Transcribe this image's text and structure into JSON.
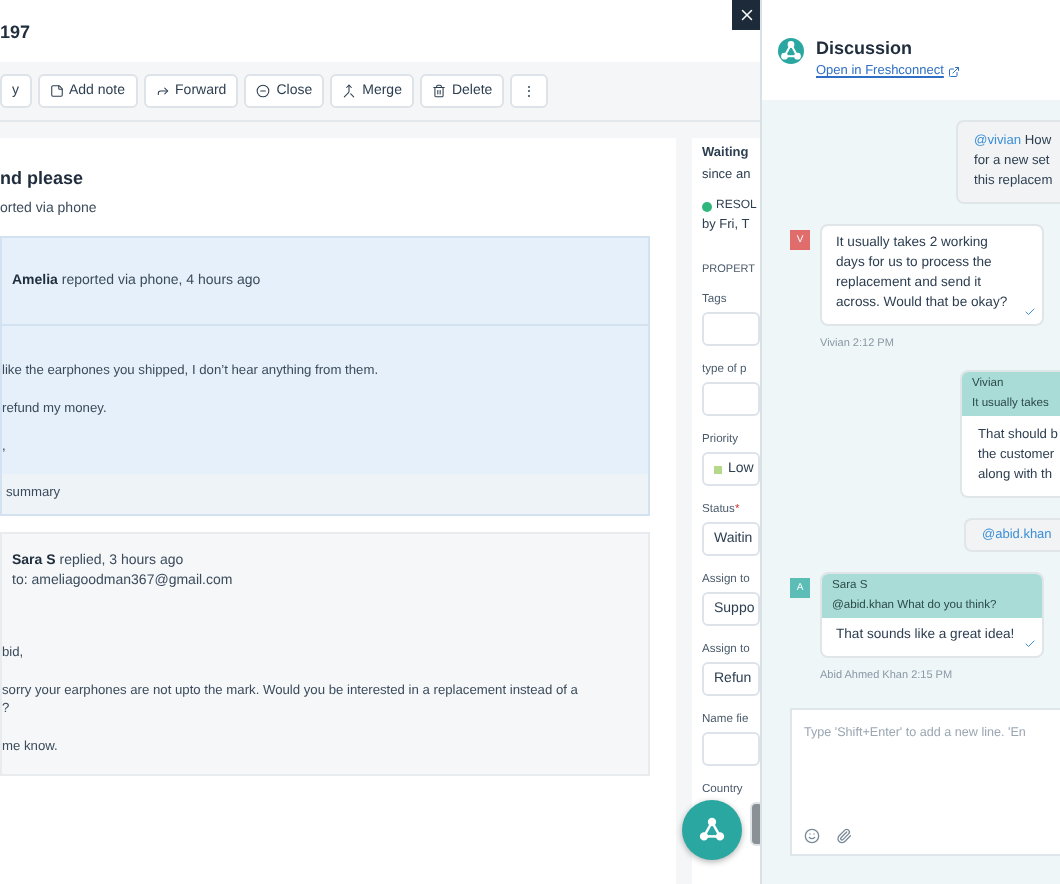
{
  "header": {
    "title": "197"
  },
  "toolbar": [
    {
      "label": "y",
      "kind": "plain"
    },
    {
      "label": "Add note",
      "kind": "note"
    },
    {
      "label": "Forward",
      "kind": "forward"
    },
    {
      "label": "Close",
      "kind": "close"
    },
    {
      "label": "Merge",
      "kind": "merge"
    },
    {
      "label": "Delete",
      "kind": "delete"
    },
    {
      "label": "⋮",
      "kind": "plain"
    }
  ],
  "ticket": {
    "subject": "nd please",
    "source": "orted via phone"
  },
  "messages": [
    {
      "kind": "customer",
      "author": "Amelia",
      "meta": "reported via phone, 4 hours ago",
      "lines": [
        "like the earphones you shipped, I don’t hear anything from them.",
        "refund my money.",
        ","
      ],
      "footer": "summary"
    },
    {
      "kind": "agent",
      "author": "Sara S",
      "meta": "replied, 3 hours ago",
      "to": "to: ameliagoodman367@gmail.com",
      "lines": [
        "bid,",
        "sorry your earphones are not upto the mark. Would you be interested in a replacement instead of a\n?",
        "me know."
      ]
    }
  ],
  "properties": {
    "status_title": "Waiting",
    "status_since": "since an",
    "sla_badge": "RESOL",
    "sla_due": "by Fri, T",
    "heading": "PROPERT",
    "fields": [
      {
        "label": "Tags"
      },
      {
        "label": "type of p"
      },
      {
        "label": "Priority",
        "value": "Low"
      },
      {
        "label": "Status",
        "required_mark": "*",
        "value": "Waitin"
      },
      {
        "label": "Assign to",
        "value": "Suppo"
      },
      {
        "label": "Assign to",
        "value": "Refun"
      },
      {
        "label": "Name fie"
      },
      {
        "label": "Country"
      }
    ]
  },
  "discussion": {
    "title": "Discussion",
    "link": "Open in Freshconnect",
    "messages": [
      {
        "kind": "outgoing",
        "mention": "@vivian",
        "lines": [
          "How",
          "for a new set",
          "this replacem"
        ]
      },
      {
        "kind": "incoming",
        "avatar": "V",
        "color": "#e06c6c",
        "text": "It usually takes 2 working days for us to process the replacement and send it across. Would that be okay?",
        "author": "Vivian",
        "time": "2:12 PM"
      },
      {
        "kind": "outgoing",
        "quote": {
          "author": "Vivian",
          "text": "It usually takes"
        },
        "lines": [
          "That should b",
          "the customer",
          "along with th"
        ]
      },
      {
        "kind": "chip",
        "text": "@abid.khan"
      },
      {
        "kind": "incoming",
        "avatar": "A",
        "color": "#5bbdb5",
        "quote": {
          "author": "Sara S",
          "text": "@abid.khan What do you think?"
        },
        "text": "That sounds like a great idea!",
        "author": "Abid Ahmed Khan",
        "time": "2:15 PM"
      }
    ],
    "composer": {
      "placeholder": "Type 'Shift+Enter' to add a new line. 'En"
    }
  }
}
